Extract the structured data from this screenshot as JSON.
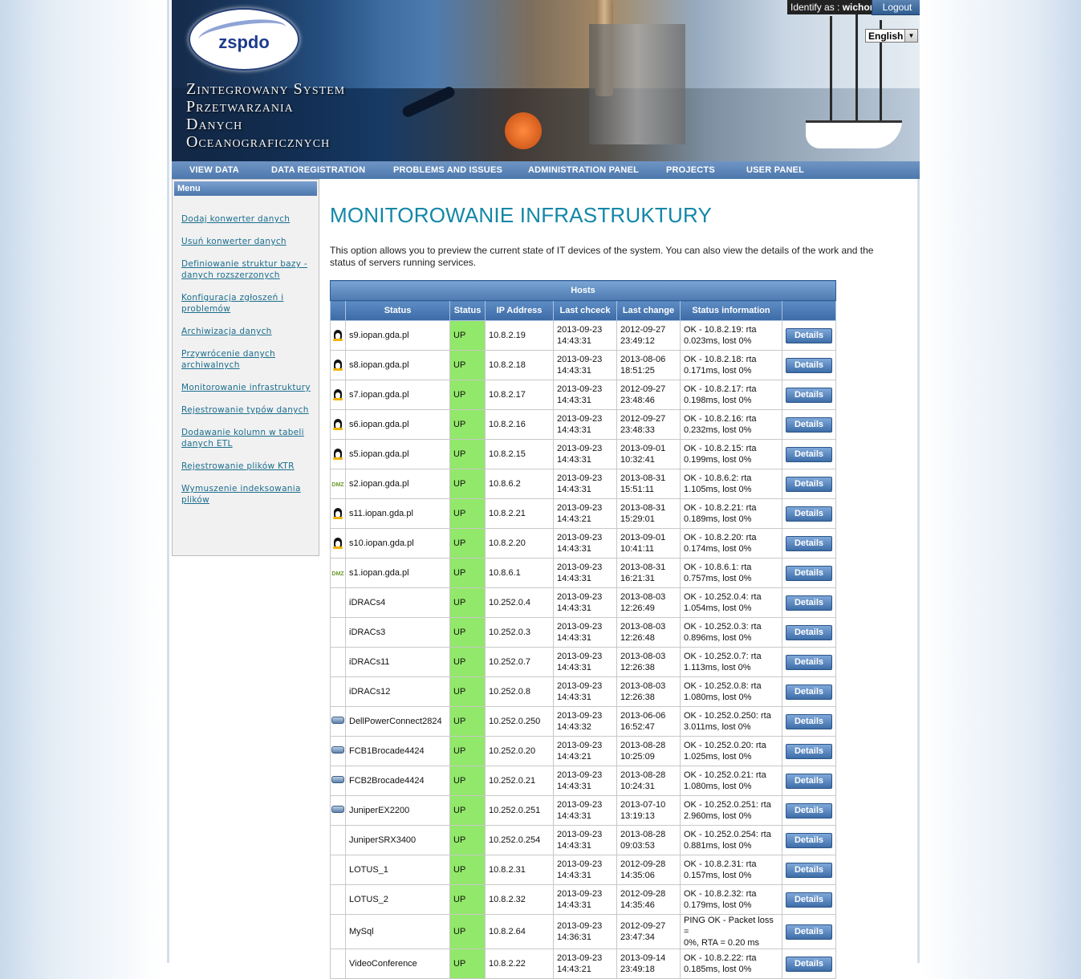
{
  "header": {
    "logo_text": "zspdo",
    "system_title": [
      "Zintegrowany System",
      "Przetwarzania",
      "Danych",
      "Oceanograficznych"
    ],
    "identify_label": "Identify as :",
    "identify_user": "wichor",
    "logout_label": "Logout",
    "language": "English"
  },
  "nav": {
    "items": [
      "VIEW DATA",
      "DATA REGISTRATION",
      "PROBLEMS AND ISSUES",
      "ADMINISTRATION PANEL",
      "PROJECTS",
      "USER PANEL"
    ]
  },
  "sidebar": {
    "title": "Menu",
    "items": [
      "Dodaj konwerter danych",
      "Usuń konwerter danych",
      "Definiowanie struktur bazy - danych rozszerzonych",
      "Konfiguracja zgłoszeń i problemów",
      "Archiwizacja danych",
      "Przywrócenie danych archiwalnych",
      "Monitorowanie infrastruktury",
      "Rejestrowanie typów danych",
      "Dodawanie kolumn w tabeli danych ETL",
      "Rejestrowanie plików KTR",
      "Wymuszenie indeksowania plików"
    ]
  },
  "main": {
    "title": "MONITOROWANIE INFRASTRUKTURY",
    "intro": "This option allows you to preview the current state of IT devices of the system. You can also view the details of the work and the status of servers running services.",
    "table_caption": "Hosts",
    "columns": [
      "",
      "Status",
      "Status",
      "IP Address",
      "Last chceck",
      "Last change",
      "Status information",
      ""
    ],
    "details_label": "Details",
    "rows": [
      {
        "icon": "linux",
        "name": "s9.iopan.gda.pl",
        "status": "UP",
        "ip": "10.8.2.19",
        "check_d": "2013-09-23",
        "check_t": "14:43:31",
        "change_d": "2012-09-27",
        "change_t": "23:49:12",
        "info1": "OK - 10.8.2.19: rta",
        "info2": "0.023ms, lost 0%"
      },
      {
        "icon": "linux",
        "name": "s8.iopan.gda.pl",
        "status": "UP",
        "ip": "10.8.2.18",
        "check_d": "2013-09-23",
        "check_t": "14:43:31",
        "change_d": "2013-08-06",
        "change_t": "18:51:25",
        "info1": "OK - 10.8.2.18: rta",
        "info2": "0.171ms, lost 0%"
      },
      {
        "icon": "linux",
        "name": "s7.iopan.gda.pl",
        "status": "UP",
        "ip": "10.8.2.17",
        "check_d": "2013-09-23",
        "check_t": "14:43:31",
        "change_d": "2012-09-27",
        "change_t": "23:48:46",
        "info1": "OK - 10.8.2.17: rta",
        "info2": "0.198ms, lost 0%"
      },
      {
        "icon": "linux",
        "name": "s6.iopan.gda.pl",
        "status": "UP",
        "ip": "10.8.2.16",
        "check_d": "2013-09-23",
        "check_t": "14:43:31",
        "change_d": "2012-09-27",
        "change_t": "23:48:33",
        "info1": "OK - 10.8.2.16: rta",
        "info2": "0.232ms, lost 0%"
      },
      {
        "icon": "linux",
        "name": "s5.iopan.gda.pl",
        "status": "UP",
        "ip": "10.8.2.15",
        "check_d": "2013-09-23",
        "check_t": "14:43:31",
        "change_d": "2013-09-01",
        "change_t": "10:32:41",
        "info1": "OK - 10.8.2.15: rta",
        "info2": "0.199ms, lost 0%"
      },
      {
        "icon": "dmz",
        "name": "s2.iopan.gda.pl",
        "status": "UP",
        "ip": "10.8.6.2",
        "check_d": "2013-09-23",
        "check_t": "14:43:31",
        "change_d": "2013-08-31",
        "change_t": "15:51:11",
        "info1": "OK - 10.8.6.2: rta",
        "info2": "1.105ms, lost 0%"
      },
      {
        "icon": "linux",
        "name": "s11.iopan.gda.pl",
        "status": "UP",
        "ip": "10.8.2.21",
        "check_d": "2013-09-23",
        "check_t": "14:43:21",
        "change_d": "2013-08-31",
        "change_t": "15:29:01",
        "info1": "OK - 10.8.2.21: rta",
        "info2": "0.189ms, lost 0%"
      },
      {
        "icon": "linux",
        "name": "s10.iopan.gda.pl",
        "status": "UP",
        "ip": "10.8.2.20",
        "check_d": "2013-09-23",
        "check_t": "14:43:31",
        "change_d": "2013-09-01",
        "change_t": "10:41:11",
        "info1": "OK - 10.8.2.20: rta",
        "info2": "0.174ms, lost 0%"
      },
      {
        "icon": "dmz",
        "name": "s1.iopan.gda.pl",
        "status": "UP",
        "ip": "10.8.6.1",
        "check_d": "2013-09-23",
        "check_t": "14:43:31",
        "change_d": "2013-08-31",
        "change_t": "16:21:31",
        "info1": "OK - 10.8.6.1: rta",
        "info2": "0.757ms, lost 0%"
      },
      {
        "icon": "none",
        "name": "iDRACs4",
        "status": "UP",
        "ip": "10.252.0.4",
        "check_d": "2013-09-23",
        "check_t": "14:43:31",
        "change_d": "2013-08-03",
        "change_t": "12:26:49",
        "info1": "OK - 10.252.0.4: rta",
        "info2": "1.054ms, lost 0%"
      },
      {
        "icon": "none",
        "name": "iDRACs3",
        "status": "UP",
        "ip": "10.252.0.3",
        "check_d": "2013-09-23",
        "check_t": "14:43:31",
        "change_d": "2013-08-03",
        "change_t": "12:26:48",
        "info1": "OK - 10.252.0.3: rta",
        "info2": "0.896ms, lost 0%"
      },
      {
        "icon": "none",
        "name": "iDRACs11",
        "status": "UP",
        "ip": "10.252.0.7",
        "check_d": "2013-09-23",
        "check_t": "14:43:31",
        "change_d": "2013-08-03",
        "change_t": "12:26:38",
        "info1": "OK - 10.252.0.7: rta",
        "info2": "1.113ms, lost 0%"
      },
      {
        "icon": "none",
        "name": "iDRACs12",
        "status": "UP",
        "ip": "10.252.0.8",
        "check_d": "2013-09-23",
        "check_t": "14:43:31",
        "change_d": "2013-08-03",
        "change_t": "12:26:38",
        "info1": "OK - 10.252.0.8: rta",
        "info2": "1.080ms, lost 0%"
      },
      {
        "icon": "switch",
        "name": "DellPowerConnect2824",
        "status": "UP",
        "ip": "10.252.0.250",
        "check_d": "2013-09-23",
        "check_t": "14:43:32",
        "change_d": "2013-06-06",
        "change_t": "16:52:47",
        "info1": "OK - 10.252.0.250: rta",
        "info2": "3.011ms, lost 0%"
      },
      {
        "icon": "switch",
        "name": "FCB1Brocade4424",
        "status": "UP",
        "ip": "10.252.0.20",
        "check_d": "2013-09-23",
        "check_t": "14:43:21",
        "change_d": "2013-08-28",
        "change_t": "10:25:09",
        "info1": "OK - 10.252.0.20: rta",
        "info2": "1.025ms, lost 0%"
      },
      {
        "icon": "switch",
        "name": "FCB2Brocade4424",
        "status": "UP",
        "ip": "10.252.0.21",
        "check_d": "2013-09-23",
        "check_t": "14:43:31",
        "change_d": "2013-08-28",
        "change_t": "10:24:31",
        "info1": "OK - 10.252.0.21: rta",
        "info2": "1.080ms, lost 0%"
      },
      {
        "icon": "switch",
        "name": "JuniperEX2200",
        "status": "UP",
        "ip": "10.252.0.251",
        "check_d": "2013-09-23",
        "check_t": "14:43:31",
        "change_d": "2013-07-10",
        "change_t": "13:19:13",
        "info1": "OK - 10.252.0.251: rta",
        "info2": "2.960ms, lost 0%"
      },
      {
        "icon": "none",
        "name": "JuniperSRX3400",
        "status": "UP",
        "ip": "10.252.0.254",
        "check_d": "2013-09-23",
        "check_t": "14:43:31",
        "change_d": "2013-08-28",
        "change_t": "09:03:53",
        "info1": "OK - 10.252.0.254: rta",
        "info2": "0.881ms, lost 0%"
      },
      {
        "icon": "none",
        "name": "LOTUS_1",
        "status": "UP",
        "ip": "10.8.2.31",
        "check_d": "2013-09-23",
        "check_t": "14:43:31",
        "change_d": "2012-09-28",
        "change_t": "14:35:06",
        "info1": "OK - 10.8.2.31: rta",
        "info2": "0.157ms, lost 0%"
      },
      {
        "icon": "none",
        "name": "LOTUS_2",
        "status": "UP",
        "ip": "10.8.2.32",
        "check_d": "2013-09-23",
        "check_t": "14:43:31",
        "change_d": "2012-09-28",
        "change_t": "14:35:46",
        "info1": "OK - 10.8.2.32: rta",
        "info2": "0.179ms, lost 0%"
      },
      {
        "icon": "none",
        "name": "MySql",
        "status": "UP",
        "ip": "10.8.2.64",
        "check_d": "2013-09-23",
        "check_t": "14:36:31",
        "change_d": "2012-09-27",
        "change_t": "23:47:34",
        "info1": "PING OK - Packet loss =",
        "info2": "0%, RTA = 0.20 ms"
      },
      {
        "icon": "none",
        "name": "VideoConference",
        "status": "UP",
        "ip": "10.8.2.22",
        "check_d": "2013-09-23",
        "check_t": "14:43:21",
        "change_d": "2013-09-14",
        "change_t": "23:49:18",
        "info1": "OK - 10.8.2.22: rta",
        "info2": "0.185ms, lost 0%"
      }
    ]
  }
}
